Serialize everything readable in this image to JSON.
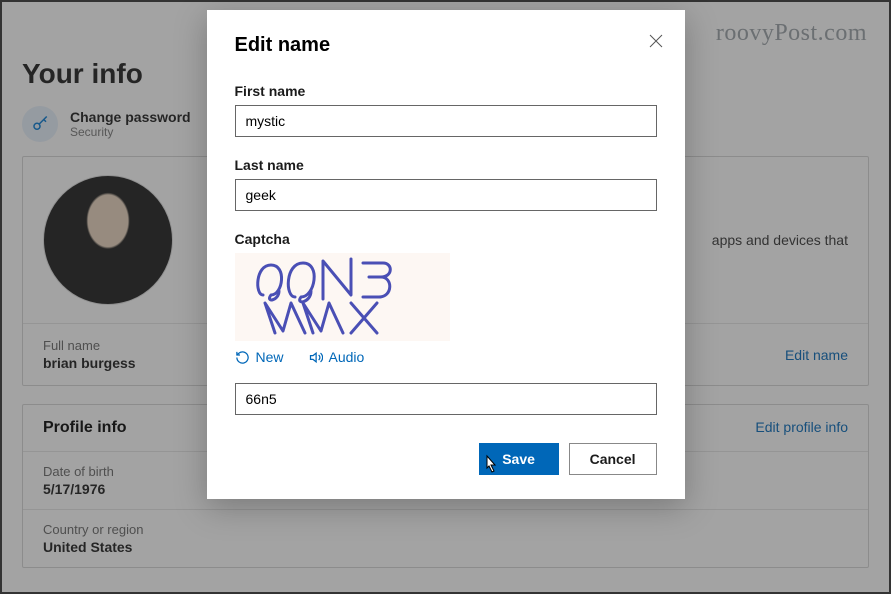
{
  "watermark": "roovyPost.com",
  "page_title": "Your info",
  "password_row": {
    "primary": "Change password",
    "secondary": "Security"
  },
  "name_card": {
    "right_text": "apps and devices that",
    "full_name_label": "Full name",
    "full_name_value": "brian burgess",
    "edit_link": "Edit name"
  },
  "profile_card": {
    "header": "Profile info",
    "edit_link": "Edit profile info",
    "dob_label": "Date of birth",
    "dob_value": "5/17/1976",
    "country_label": "Country or region",
    "country_value": "United States"
  },
  "modal": {
    "title": "Edit name",
    "first_name_label": "First name",
    "first_name_value": "mystic",
    "last_name_label": "Last name",
    "last_name_value": "geek",
    "captcha_label": "Captcha",
    "captcha_text": "66N5 WWX",
    "new_label": "New",
    "audio_label": "Audio",
    "captcha_input_value": "66n5",
    "save_label": "Save",
    "cancel_label": "Cancel"
  }
}
